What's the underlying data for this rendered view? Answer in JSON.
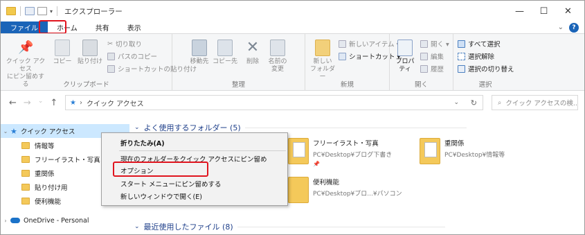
{
  "title": "エクスプローラー",
  "window_buttons": {
    "minimize": "—",
    "maximize": "☐",
    "close": "✕"
  },
  "tabs": [
    "ファイル",
    "ホーム",
    "共有",
    "表示"
  ],
  "tabs_right": {
    "expand": "⌄",
    "help": "?"
  },
  "ribbon": {
    "clipboard": {
      "pin": "クイック アクセス\nにピン留めする",
      "copy": "コピー",
      "paste": "貼り付け",
      "cut": "切り取り",
      "copy_path": "パスのコピー",
      "paste_shortcut": "ショートカットの貼り付け",
      "label": "クリップボード"
    },
    "organize": {
      "move_to": "移動先",
      "copy_to": "コピー先",
      "delete": "削除",
      "rename": "名前の\n変更",
      "label": "整理"
    },
    "new": {
      "new_folder": "新しい\nフォルダー",
      "new_item": "新しいアイテム ▾",
      "shortcut": "ショートカット ▾",
      "label": "新規"
    },
    "open": {
      "properties": "プロパティ",
      "open": "開く ▾",
      "edit": "編集",
      "history": "履歴",
      "label": "開く"
    },
    "select": {
      "select_all": "すべて選択",
      "select_none": "選択解除",
      "invert": "選択の切り替え",
      "label": "選択"
    }
  },
  "address": {
    "back": "←",
    "forward": "→",
    "recent": "⌄",
    "up": "↑",
    "separator": "›",
    "crumb": "クイック アクセス",
    "dropdown": "⌄",
    "refresh": "↻",
    "search_placeholder": "クイック アクセスの検..."
  },
  "nav": {
    "quick_access": "クイック アクセス",
    "items": [
      "情報等",
      "フリーイラスト・写真",
      "重関係",
      "貼り付け用",
      "便利機能"
    ],
    "onedrive": "OneDrive - Personal"
  },
  "content": {
    "frequent_header": "よく使用するフォルダー (5)",
    "recent_header": "最近使用したファイル (8)",
    "tiles": [
      {
        "name": "フリーイラスト・写真",
        "path": "PC¥Desktop¥ブログ下書き"
      },
      {
        "name": "重関係",
        "path": "PC¥Desktop¥情報等"
      },
      {
        "name": "便利機能",
        "path": "PC¥Desktop¥ブロ...¥パソコン"
      }
    ]
  },
  "context_menu": {
    "items": [
      "折りたたみ(A)",
      "現在のフォルダーをクイック アクセスにピン留め",
      "オプション",
      "スタート メニューにピン留めする",
      "新しいウィンドウで開く(E)"
    ]
  },
  "icons": {
    "pin": "📌",
    "star": "★",
    "search": "⌕",
    "cut": "✂",
    "delete": "✕"
  },
  "colors": {
    "file_tab": "#1a64b8",
    "highlight": "#e0141e",
    "nav_selected": "#cce8ff",
    "section_header": "#1e3f8a"
  }
}
